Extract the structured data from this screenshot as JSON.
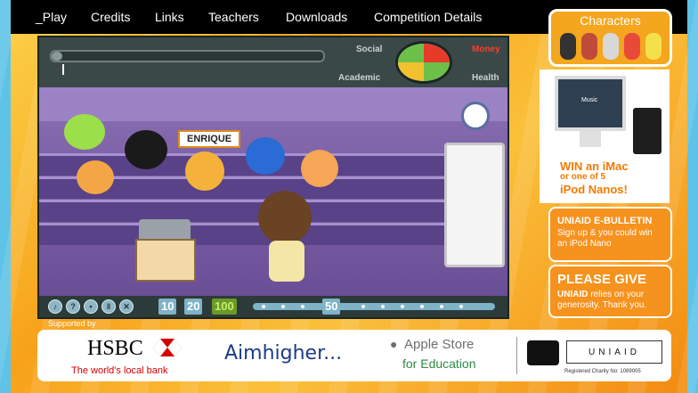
{
  "nav": {
    "items": [
      "_Play",
      "Credits",
      "Links",
      "Teachers",
      "Downloads",
      "Competition Details"
    ]
  },
  "game": {
    "stats": {
      "social": "Social",
      "money": "Money",
      "academic": "Academic",
      "health": "Health"
    },
    "speaker_name": "ENRIQUE",
    "numbers": [
      "10",
      "20",
      "100"
    ],
    "track_label": "50",
    "colors": {
      "money": "#ff3a2a",
      "dial_green": "#6cc04a",
      "dial_red": "#e63a2a",
      "dial_yellow": "#f2c12e"
    }
  },
  "supported_by": "Supported by",
  "ads": {
    "characters_title": "Characters",
    "imac": {
      "screen_label": "Music",
      "line1": "WIN an iMac",
      "line2": "or one of 5",
      "line3": "iPod Nanos!"
    },
    "bulletin": {
      "title": "UNIAID E-BULLETIN",
      "text": "Sign up & you could win an iPod Nano"
    },
    "give": {
      "title": "PLEASE GIVE",
      "text_bold": "UNIAID",
      "text": " relies on your generosity. Thank you."
    }
  },
  "sponsors": {
    "hsbc": "HSBC",
    "hsbc_tagline": "The world's local bank",
    "aimhigher": "Aimhigher...",
    "apple_line1": "Apple Store",
    "apple_line2": "for Education",
    "uniaid": "UNIAID",
    "uniaid_reg": "Registered Charity No: 1089005"
  }
}
